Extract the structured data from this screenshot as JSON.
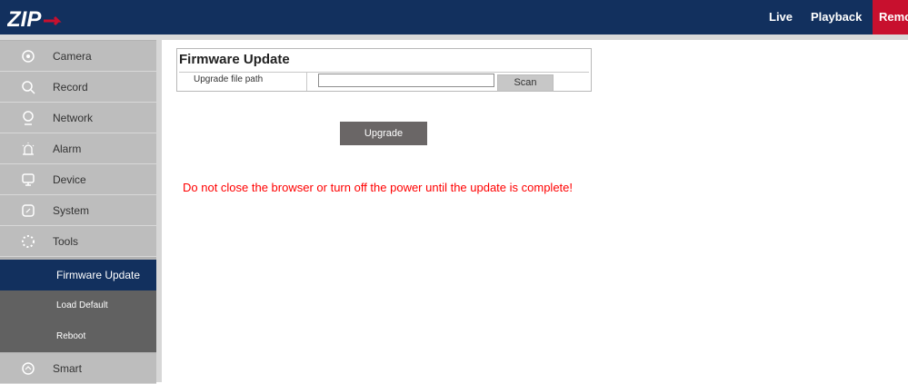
{
  "brand": {
    "logo_text": "ZIP",
    "bar_color": "#12305e",
    "accent": "#c8102e"
  },
  "topnav": {
    "live": "Live",
    "playback": "Playback",
    "remote": "Remote"
  },
  "sidebar": {
    "items": [
      {
        "label": "Camera",
        "icon": "camera-icon"
      },
      {
        "label": "Record",
        "icon": "search-icon"
      },
      {
        "label": "Network",
        "icon": "network-icon"
      },
      {
        "label": "Alarm",
        "icon": "alarm-icon"
      },
      {
        "label": "Device",
        "icon": "monitor-icon"
      },
      {
        "label": "System",
        "icon": "system-icon"
      },
      {
        "label": "Tools",
        "icon": "tools-icon"
      }
    ],
    "tools_submenu": [
      {
        "label": "Firmware Update",
        "active": true
      },
      {
        "label": "Load Default",
        "active": false
      },
      {
        "label": "Reboot",
        "active": false
      }
    ],
    "after_items": [
      {
        "label": "Smart",
        "icon": "smart-icon"
      }
    ]
  },
  "main": {
    "title": "Firmware Update",
    "row_label": "Upgrade file path",
    "path_value": "",
    "scan_label": "Scan",
    "upgrade_label": "Upgrade",
    "warning": "Do not close the browser or turn off the power until the update is complete!",
    "warning_color": "#ff0000"
  }
}
